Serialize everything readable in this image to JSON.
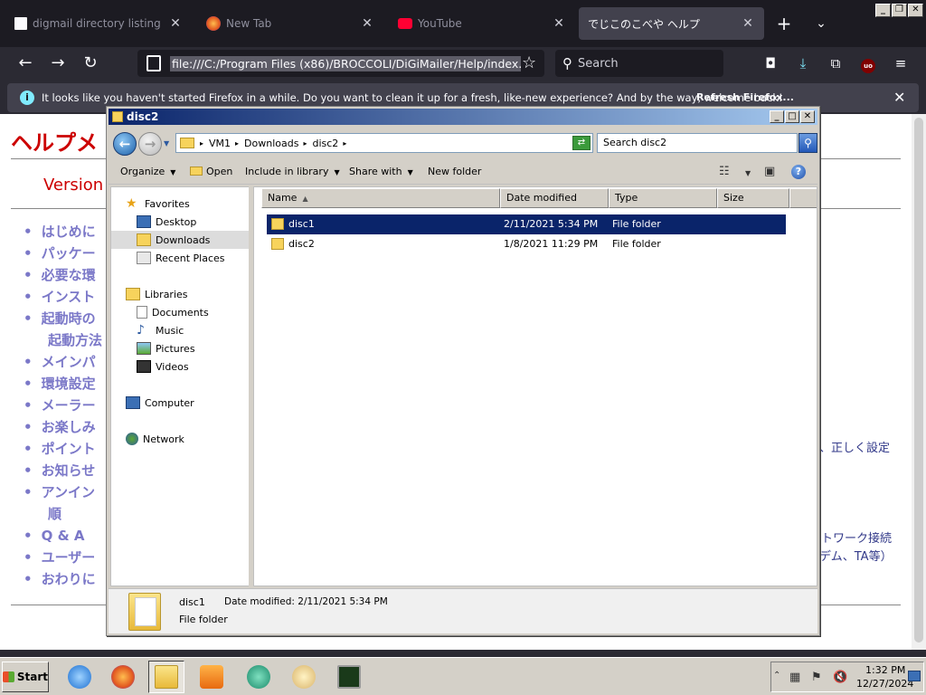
{
  "browser": {
    "tabs": [
      {
        "label": "digmail directory listing",
        "active": false
      },
      {
        "label": "New Tab",
        "active": false
      },
      {
        "label": "YouTube",
        "active": false
      },
      {
        "label": "でじこのこべや ヘルプ",
        "active": true
      }
    ],
    "url": "file:///C:/Program Files (x86)/BROCCOLI/DiGiMailer/Help/index.html",
    "search_placeholder": "Search",
    "notification": {
      "text": "It looks like you haven't started Firefox in a while. Do you want to clean it up for a fresh, like-new experience? And by the way, welcome back!",
      "button": "Refresh Firefox..."
    }
  },
  "page": {
    "title": "ヘルプメ",
    "version": "Version",
    "toc": [
      "はじめに",
      "パッケー",
      "必要な環",
      "インスト",
      "起動時の",
      "起動方法",
      "メインパ",
      "環境設定",
      "メーラー",
      "お楽しみ",
      "ポイント",
      "お知らせ",
      "アンイン",
      "順",
      "Q & A",
      "ユーザー",
      "おわりに"
    ],
    "right_fragments": [
      "、正しく設定",
      "トワーク接続",
      "デム、TA等）"
    ]
  },
  "explorer": {
    "title": "disc2",
    "breadcrumb": [
      "VM1",
      "Downloads",
      "disc2"
    ],
    "search_placeholder": "Search disc2",
    "commands": {
      "organize": "Organize",
      "open": "Open",
      "include": "Include in library",
      "share": "Share with",
      "new_folder": "New folder"
    },
    "nav": {
      "favorites": "Favorites",
      "desktop": "Desktop",
      "downloads": "Downloads",
      "recent": "Recent Places",
      "libraries": "Libraries",
      "documents": "Documents",
      "music": "Music",
      "pictures": "Pictures",
      "videos": "Videos",
      "computer": "Computer",
      "network": "Network"
    },
    "columns": {
      "name": "Name",
      "date": "Date modified",
      "type": "Type",
      "size": "Size"
    },
    "files": [
      {
        "name": "disc1",
        "date": "2/11/2021 5:34 PM",
        "type": "File folder",
        "selected": true
      },
      {
        "name": "disc2",
        "date": "1/8/2021 11:29 PM",
        "type": "File folder",
        "selected": false
      }
    ],
    "details": {
      "name": "disc1",
      "modified": "Date modified:  2/11/2021 5:34 PM",
      "type": "File folder"
    }
  },
  "taskbar": {
    "start": "Start",
    "time": "1:32 PM",
    "date": "12/27/2024"
  }
}
